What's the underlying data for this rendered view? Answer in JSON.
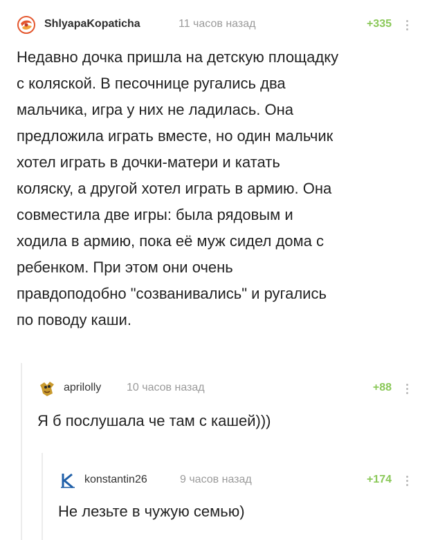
{
  "comments": [
    {
      "author": "ShlyapaKopaticha",
      "time": "11 часов назад",
      "rating": "+335",
      "avatar_icon": "orange-swirl-avatar-icon",
      "text": "Недавно дочка пришла на детскую площадку\nс коляской. В песочнице ругались два\nмальчика, игра у них не ладилась. Она\nпредложила играть вместе, но один мальчик\nхотел играть в дочки-матери и катать\nколяску, а другой хотел играть в армию. Она\nсовместила две игры: была рядовым и\nходила в армию, пока её муж сидел дома с\nребенком. При этом они очень\nправдоподобно \"созванивались\" и ругались\nпо поводу каши."
    },
    {
      "author": "aprilolly",
      "time": "10 часов назад",
      "rating": "+88",
      "avatar_icon": "cartoon-avatar-icon",
      "text": "Я б послушала че там с кашей)))"
    },
    {
      "author": "konstantin26",
      "time": "9 часов назад",
      "rating": "+174",
      "avatar_icon": "letter-k-avatar-icon",
      "text": "Не лезьте в чужую семью)"
    }
  ],
  "colors": {
    "rating_positive": "#8ac858",
    "meta_gray": "#9a9a9a",
    "branch_line": "#ececec"
  }
}
